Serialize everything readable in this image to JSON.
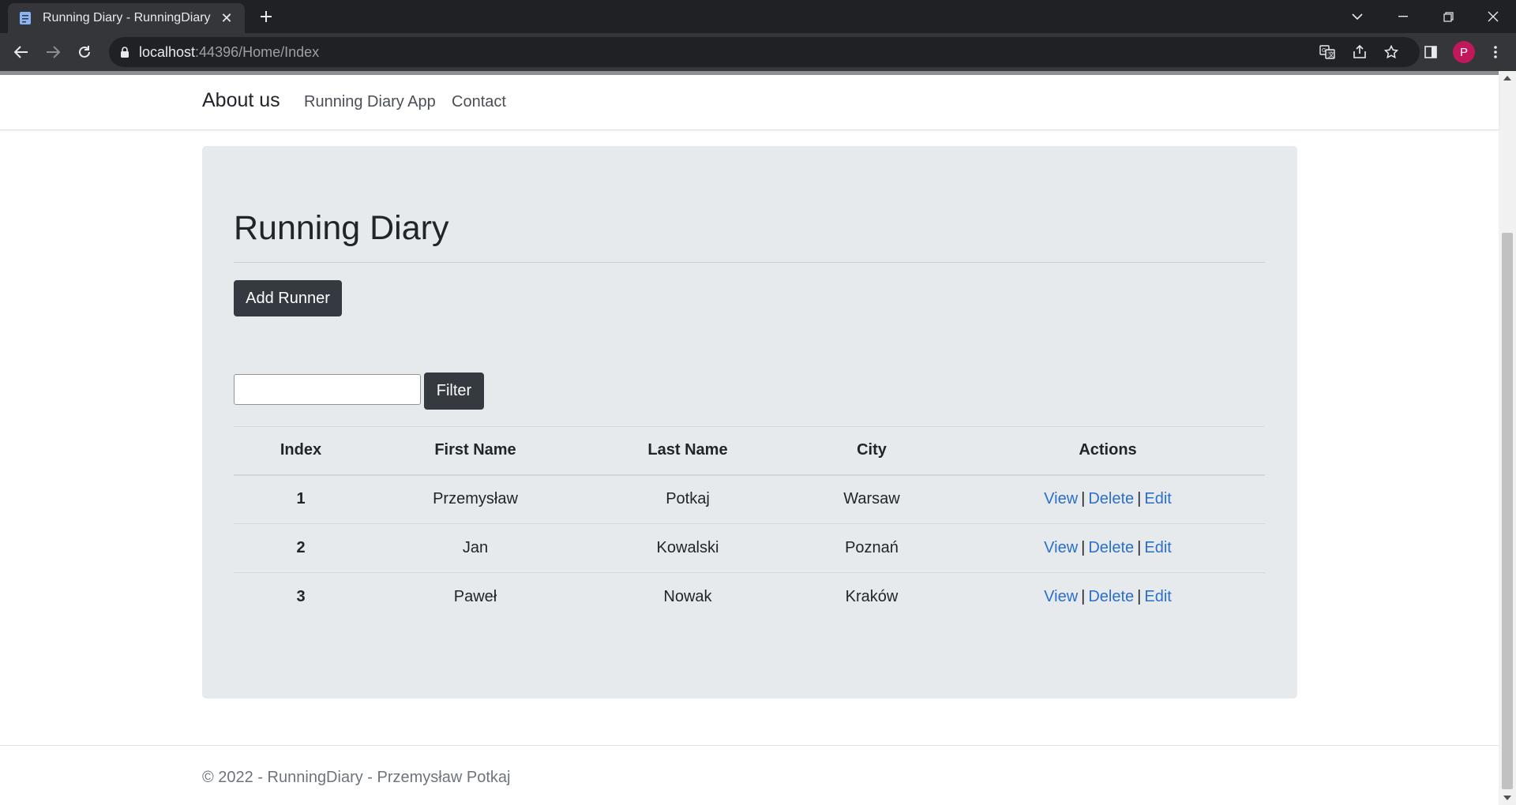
{
  "browser": {
    "tab_title": "Running Diary - RunningDiary",
    "url_host": "localhost",
    "url_rest": ":44396/Home/Index",
    "avatar_letter": "P",
    "avatar_color": "#c2185b"
  },
  "navbar": {
    "brand": "About us",
    "links": [
      "Running Diary App",
      "Contact"
    ]
  },
  "main": {
    "heading": "Running Diary",
    "add_button": "Add Runner",
    "filter_value": "",
    "filter_button": "Filter"
  },
  "table": {
    "headers": [
      "Index",
      "First Name",
      "Last Name",
      "City",
      "Actions"
    ],
    "rows": [
      {
        "index": "1",
        "first_name": "Przemysław",
        "last_name": "Potkaj",
        "city": "Warsaw"
      },
      {
        "index": "2",
        "first_name": "Jan",
        "last_name": "Kowalski",
        "city": "Poznań"
      },
      {
        "index": "3",
        "first_name": "Paweł",
        "last_name": "Nowak",
        "city": "Kraków"
      }
    ],
    "actions": {
      "view": "View",
      "delete": "Delete",
      "edit": "Edit",
      "separator": "|"
    }
  },
  "footer": {
    "text": "© 2022 - RunningDiary - Przemysław Potkaj"
  },
  "colors": {
    "jumbotron_bg": "#e7eaed",
    "button_dark": "#343a40",
    "link_blue": "#2a6fc9",
    "chrome_dark": "#202124"
  }
}
